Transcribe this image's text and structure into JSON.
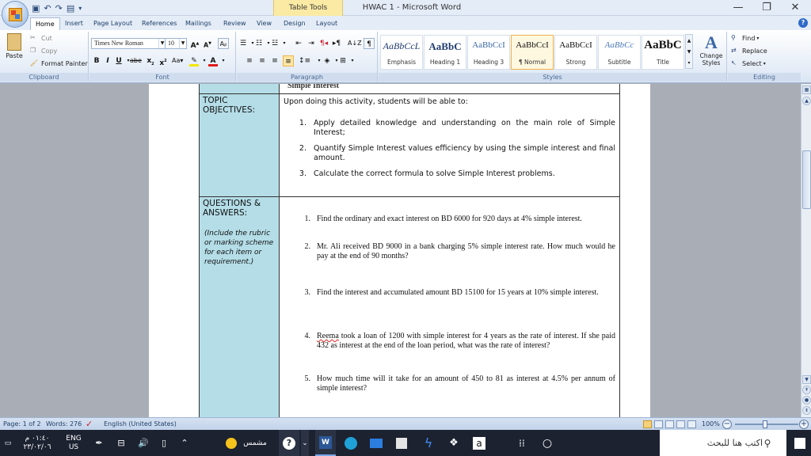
{
  "window": {
    "title": "HWAC 1 - Microsoft Word",
    "context_tab": "Table Tools",
    "minimize": "—",
    "restore": "❐",
    "close": "✕"
  },
  "tabs": [
    "Home",
    "Insert",
    "Page Layout",
    "References",
    "Mailings",
    "Review",
    "View",
    "Design",
    "Layout"
  ],
  "ribbon": {
    "clipboard": {
      "label": "Clipboard",
      "paste": "Paste",
      "cut": "Cut",
      "copy": "Copy",
      "format_painter": "Format Painter"
    },
    "font": {
      "label": "Font",
      "font_name": "Times New Roman",
      "font_size": "10"
    },
    "paragraph": {
      "label": "Paragraph"
    },
    "styles": {
      "label": "Styles",
      "items": [
        {
          "preview": "AaBbCcL",
          "name": "Emphasis"
        },
        {
          "preview": "AaBbC",
          "name": "Heading 1"
        },
        {
          "preview": "AaBbCcI",
          "name": "Heading 3"
        },
        {
          "preview": "AaBbCcI",
          "name": "¶ Normal"
        },
        {
          "preview": "AaBbCcI",
          "name": "Strong"
        },
        {
          "preview": "AaBbCc",
          "name": "Subtitle"
        },
        {
          "preview": "AaBbC",
          "name": "Title"
        }
      ],
      "change_styles": "Change Styles"
    },
    "editing": {
      "label": "Editing",
      "find": "Find",
      "replace": "Replace",
      "select": "Select"
    }
  },
  "document": {
    "top_cut_text": "Simple Interest",
    "rows": [
      {
        "label": "TOPIC OBJECTIVES:",
        "intro": "Upon doing this activity, students will be able to:",
        "items": [
          {
            "num": "1.",
            "text": "Apply detailed knowledge and understanding on the main role of Simple Interest;"
          },
          {
            "num": "2.",
            "text": "Quantify Simple Interest values efficiency by using the simple interest and final amount."
          },
          {
            "num": "3.",
            "text": "Calculate the correct formula to solve Simple Interest problems."
          }
        ]
      },
      {
        "label": "QUESTIONS & ANSWERS:",
        "note": "(Include the rubric or marking scheme for each item or requirement.)",
        "questions": [
          {
            "num": "1.",
            "text": "Find the ordinary and exact interest on BD 6000 for 920 days at 4% simple interest."
          },
          {
            "num": "2.",
            "text": "Mr. Ali received BD 9000 in a bank charging 5% simple interest rate. How much would he pay at the end of 90 months?"
          },
          {
            "num": "3.",
            "text": "Find the interest and accumulated amount BD 15100 for 15 years at 10% simple interest."
          },
          {
            "num": "4.",
            "word": "Reema",
            "text": " took a loan of 1200 with simple interest for 4 years as the rate of interest. If she paid 432 as interest at the end of the loan period, what was the rate of interest?"
          },
          {
            "num": "5.",
            "text": "How much time will it take for an amount of 450 to 81 as interest at 4.5% per annum of simple interest?"
          }
        ]
      }
    ]
  },
  "statusbar": {
    "page": "Page: 1 of 2",
    "words": "Words: 276",
    "language": "English (United States)",
    "zoom": "100%"
  },
  "taskbar": {
    "time": "٠١:٤٠ م",
    "date": "٢٣/٠٢/٠٦",
    "lang_top": "ENG",
    "lang_bottom": "US",
    "weather": "مشمس",
    "search_placeholder": "اكتب هنا للبحث"
  }
}
